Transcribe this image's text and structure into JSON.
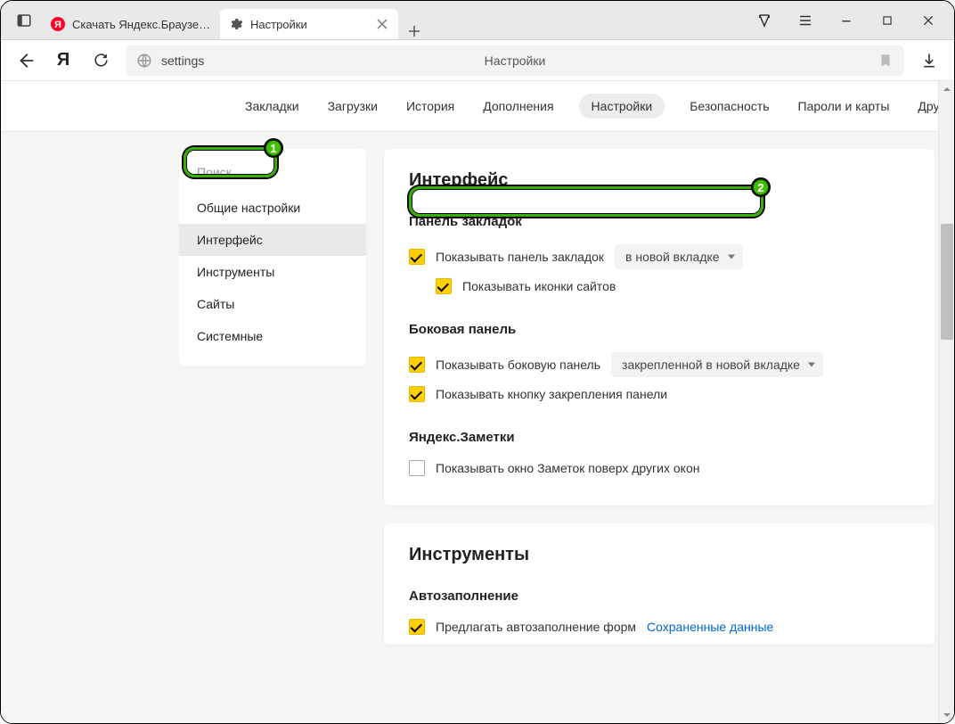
{
  "titlebar": {
    "tabs": [
      {
        "label": "Скачать Яндекс.Браузер д",
        "active": false
      },
      {
        "label": "Настройки",
        "active": true
      }
    ]
  },
  "navbar": {
    "url_text": "settings",
    "page_title": "Настройки",
    "home_letter": "Я"
  },
  "topnav": {
    "items": [
      "Закладки",
      "Загрузки",
      "История",
      "Дополнения",
      "Настройки",
      "Безопасность",
      "Пароли и карты",
      "Другие устро"
    ],
    "active_index": 4
  },
  "sidebar": {
    "search_placeholder": "Поиск",
    "items": [
      "Общие настройки",
      "Интерфейс",
      "Инструменты",
      "Сайты",
      "Системные"
    ],
    "active_index": 1
  },
  "interface": {
    "heading": "Интерфейс",
    "bookmarks": {
      "section": "Панель закладок",
      "show_panel_label": "Показывать панель закладок",
      "show_panel_checked": true,
      "mode_select": "в новой вкладке",
      "show_icons_label": "Показывать иконки сайтов",
      "show_icons_checked": true
    },
    "sidepanel": {
      "section": "Боковая панель",
      "show_label": "Показывать боковую панель",
      "show_checked": true,
      "mode_select": "закрепленной в новой вкладке",
      "pin_btn_label": "Показывать кнопку закрепления панели",
      "pin_btn_checked": true
    },
    "notes": {
      "section": "Яндекс.Заметки",
      "show_label": "Показывать окно Заметок поверх других окон",
      "show_checked": false
    }
  },
  "tools": {
    "heading": "Инструменты",
    "autofill": {
      "section": "Автозаполнение",
      "offer_label": "Предлагать автозаполнение форм",
      "offer_checked": true,
      "saved_link": "Сохраненные данные"
    }
  },
  "badges": {
    "one": "1",
    "two": "2"
  }
}
